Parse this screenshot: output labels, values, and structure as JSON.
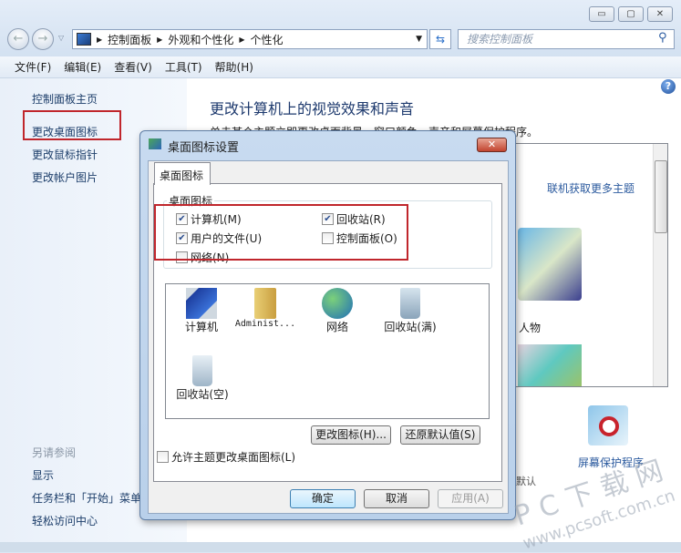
{
  "window": {
    "caption_buttons": [
      "minimize",
      "maximize",
      "close"
    ]
  },
  "address": {
    "crumbs": [
      "控制面板",
      "外观和个性化",
      "个性化"
    ],
    "search_placeholder": "搜索控制面板"
  },
  "menu": [
    "文件(F)",
    "编辑(E)",
    "查看(V)",
    "工具(T)",
    "帮助(H)"
  ],
  "sidebar": {
    "items": [
      "控制面板主页",
      "更改桌面图标",
      "更改鼠标指针",
      "更改帐户图片"
    ],
    "see_also_title": "另请参阅",
    "see_also": [
      "显示",
      "任务栏和「开始」菜单",
      "轻松访问中心"
    ]
  },
  "main": {
    "title": "更改计算机上的视觉效果和声音",
    "subtitle": "单击某个主题立即更改桌面背景、窗口颜色、声音和屏幕保护程序。",
    "online_themes": "联机获取更多主题",
    "theme_label": "人物",
    "screensaver": "屏幕保护程序",
    "default_fragment": "默认"
  },
  "dialog": {
    "title": "桌面图标设置",
    "tab": "桌面图标",
    "group": "桌面图标",
    "checkboxes": [
      {
        "label": "计算机(M)",
        "checked": true
      },
      {
        "label": "回收站(R)",
        "checked": true
      },
      {
        "label": "用户的文件(U)",
        "checked": true
      },
      {
        "label": "控制面板(O)",
        "checked": false
      },
      {
        "label": "网络(N)",
        "checked": false
      }
    ],
    "icons": [
      {
        "label": "计算机",
        "icon": "computer-icon"
      },
      {
        "label": "Administ...",
        "icon": "user-folder-icon"
      },
      {
        "label": "网络",
        "icon": "network-icon"
      },
      {
        "label": "回收站(满)",
        "icon": "recycle-bin-full-icon"
      },
      {
        "label": "回收站(空)",
        "icon": "recycle-bin-empty-icon"
      }
    ],
    "change_icon": "更改图标(H)...",
    "restore_default": "还原默认值(S)",
    "allow_themes": {
      "label": "允许主题更改桌面图标(L)",
      "checked": false
    },
    "ok": "确定",
    "cancel": "取消",
    "apply": "应用(A)"
  },
  "watermark": {
    "text": "PC下载网",
    "url": "www.pcsoft.com.cn"
  },
  "colors": {
    "link": "#1d3e6a",
    "highlight": "#c0262c",
    "accent": "#2b5a9e"
  }
}
